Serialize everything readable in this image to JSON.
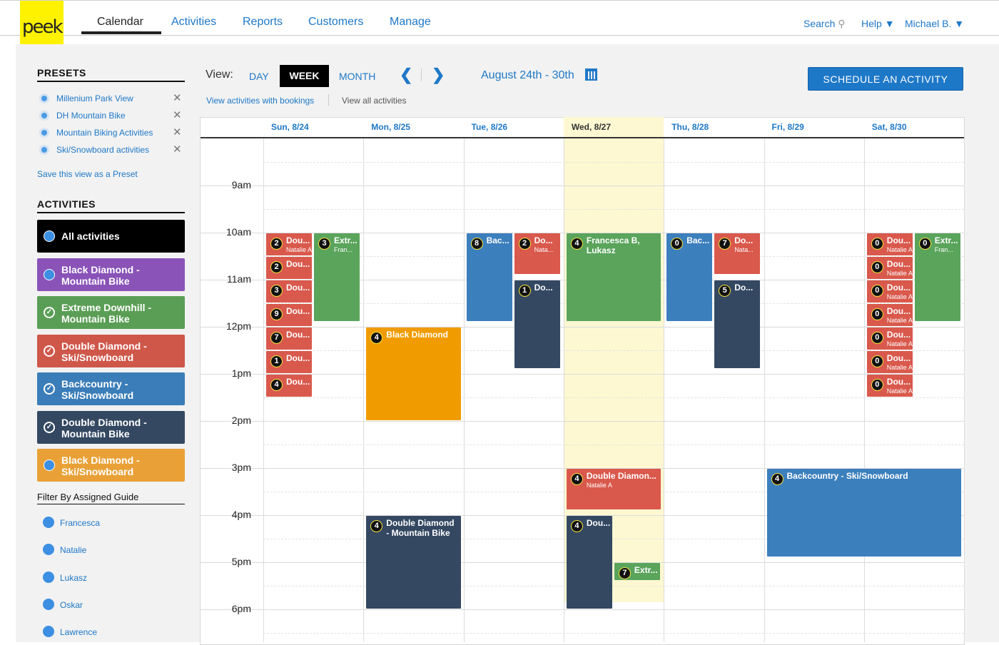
{
  "logo": "peek",
  "nav": {
    "items": [
      "Calendar",
      "Activities",
      "Reports",
      "Customers",
      "Manage"
    ],
    "active": "Calendar"
  },
  "top_right": {
    "search": "Search",
    "help": "Help",
    "user": "Michael B."
  },
  "presets": {
    "title": "PRESETS",
    "items": [
      "Millenium Park View",
      "DH Mountain Bike",
      "Mountain Biking Activities",
      "Ski/Snowboard activities"
    ],
    "save_link": "Save this view as a Preset"
  },
  "activities": {
    "title": "ACTIVITIES",
    "items": [
      {
        "label": "All activities",
        "color": "#000000",
        "state": "dot"
      },
      {
        "label": "Black Diamond - Mountain Bike",
        "color": "#8a53b8",
        "state": "dot"
      },
      {
        "label": "Extreme Downhill - Mountain Bike",
        "color": "#5a9e55",
        "state": "check"
      },
      {
        "label": "Double Diamond - Ski/Snowboard",
        "color": "#cf574a",
        "state": "check"
      },
      {
        "label": "Backcountry - Ski/Snowboard",
        "color": "#3a7db8",
        "state": "check"
      },
      {
        "label": "Double Diamond - Mountain Bike",
        "color": "#344862",
        "state": "check"
      },
      {
        "label": "Black Diamond - Ski/Snowboard",
        "color": "#e9a137",
        "state": "dot"
      }
    ]
  },
  "guides": {
    "title": "Filter By Assigned Guide",
    "items": [
      "Francesca",
      "Natalie",
      "Lukasz",
      "Oskar",
      "Lawrence"
    ]
  },
  "toolbar": {
    "view_label": "View:",
    "views": [
      "DAY",
      "WEEK",
      "MONTH"
    ],
    "active_view": "WEEK",
    "date_range": "August 24th - 30th",
    "schedule_button": "SCHEDULE AN ACTIVITY",
    "link_bookings": "View activities with bookings",
    "link_all": "View all activities"
  },
  "days": [
    {
      "label": "Sun, 8/24",
      "today": false
    },
    {
      "label": "Mon, 8/25",
      "today": false
    },
    {
      "label": "Tue, 8/26",
      "today": false
    },
    {
      "label": "Wed, 8/27",
      "today": true
    },
    {
      "label": "Thu, 8/28",
      "today": false
    },
    {
      "label": "Fri, 8/29",
      "today": false
    },
    {
      "label": "Sat, 8/30",
      "today": false
    }
  ],
  "hours": [
    "9am",
    "10am",
    "11am",
    "12pm",
    "1pm",
    "2pm",
    "3pm",
    "4pm",
    "5pm",
    "6pm"
  ],
  "colors": {
    "red": "#d9594c",
    "green": "#5aa45c",
    "blue": "#3c7fbd",
    "navy": "#344862",
    "orange": "#f09c00",
    "today": "#fdf8d1",
    "brand_blue": "#1e78c8"
  },
  "events": [
    {
      "day": 0,
      "col": 0,
      "start": 10,
      "end": 10.5,
      "color": "red",
      "count": "2",
      "title": "Dou...",
      "sub": "Natalie A"
    },
    {
      "day": 0,
      "col": 0,
      "start": 10.5,
      "end": 11,
      "color": "red",
      "count": "2",
      "title": "Dou...",
      "sub": ""
    },
    {
      "day": 0,
      "col": 0,
      "start": 11,
      "end": 11.5,
      "color": "red",
      "count": "3",
      "title": "Dou...",
      "sub": ""
    },
    {
      "day": 0,
      "col": 0,
      "start": 11.5,
      "end": 12,
      "color": "red",
      "count": "9",
      "title": "Dou...",
      "sub": ""
    },
    {
      "day": 0,
      "col": 0,
      "start": 12,
      "end": 12.5,
      "color": "red",
      "count": "7",
      "title": "Dou...",
      "sub": ""
    },
    {
      "day": 0,
      "col": 0,
      "start": 12.5,
      "end": 13,
      "color": "red",
      "count": "1",
      "title": "Dou...",
      "sub": ""
    },
    {
      "day": 0,
      "col": 0,
      "start": 13,
      "end": 13.5,
      "color": "red",
      "count": "4",
      "title": "Dou...",
      "sub": ""
    },
    {
      "day": 0,
      "col": 1,
      "start": 10,
      "end": 11.9,
      "color": "green",
      "count": "3",
      "title": "Extr...",
      "sub": "Fran..."
    },
    {
      "day": 1,
      "col": -1,
      "start": 12,
      "end": 14,
      "color": "orange",
      "count": "4",
      "title": "Black Diamond",
      "sub": ""
    },
    {
      "day": 1,
      "col": -1,
      "start": 16,
      "end": 18,
      "color": "navy",
      "count": "4",
      "title": "Double Diamond - Mountain Bike",
      "sub": ""
    },
    {
      "day": 2,
      "col": 0,
      "start": 10,
      "end": 11.9,
      "color": "blue",
      "count": "8",
      "title": "Bac...",
      "sub": ""
    },
    {
      "day": 2,
      "col": 1,
      "start": 10,
      "end": 10.9,
      "color": "red",
      "count": "2",
      "title": "Do...",
      "sub": "Nata..."
    },
    {
      "day": 2,
      "col": 1,
      "start": 11,
      "end": 12.9,
      "color": "navy",
      "count": "1",
      "title": "Do...",
      "sub": ""
    },
    {
      "day": 3,
      "col": -1,
      "start": 10,
      "end": 11.9,
      "color": "green",
      "count": "4",
      "title": "Francesca B, Lukasz",
      "sub": ""
    },
    {
      "day": 3,
      "col": -1,
      "start": 15,
      "end": 15.9,
      "color": "red",
      "count": "4",
      "title": "Double Diamon...",
      "sub": "Natalie A"
    },
    {
      "day": 3,
      "col": 0,
      "start": 16,
      "end": 18,
      "color": "navy",
      "count": "4",
      "title": "Dou...",
      "sub": ""
    },
    {
      "day": 3,
      "col": 1,
      "start": 17,
      "end": 17.4,
      "color": "green",
      "count": "7",
      "title": "Extr...",
      "sub": ""
    },
    {
      "day": 4,
      "col": 0,
      "start": 10,
      "end": 11.9,
      "color": "blue",
      "count": "0",
      "title": "Bac...",
      "sub": ""
    },
    {
      "day": 4,
      "col": 1,
      "start": 10,
      "end": 10.9,
      "color": "red",
      "count": "7",
      "title": "Do...",
      "sub": "Nata..."
    },
    {
      "day": 4,
      "col": 1,
      "start": 11,
      "end": 12.9,
      "color": "navy",
      "count": "5",
      "title": "Do...",
      "sub": ""
    },
    {
      "day": 5,
      "col": -1,
      "start": 15,
      "end": 16.9,
      "color": "blue",
      "count": "4",
      "title": "Backcountry - Ski/Snowboard",
      "sub": ""
    },
    {
      "day": 6,
      "col": 0,
      "start": 10,
      "end": 10.5,
      "color": "red",
      "count": "0",
      "title": "Dou...",
      "sub": "Natalie A"
    },
    {
      "day": 6,
      "col": 0,
      "start": 10.5,
      "end": 11,
      "color": "red",
      "count": "0",
      "title": "Dou...",
      "sub": "Natalie A"
    },
    {
      "day": 6,
      "col": 0,
      "start": 11,
      "end": 11.5,
      "color": "red",
      "count": "0",
      "title": "Dou...",
      "sub": "Natalie A"
    },
    {
      "day": 6,
      "col": 0,
      "start": 11.5,
      "end": 12,
      "color": "red",
      "count": "0",
      "title": "Dou...",
      "sub": "Natalie A"
    },
    {
      "day": 6,
      "col": 0,
      "start": 12,
      "end": 12.5,
      "color": "red",
      "count": "0",
      "title": "Dou...",
      "sub": "Natalie A"
    },
    {
      "day": 6,
      "col": 0,
      "start": 12.5,
      "end": 13,
      "color": "red",
      "count": "0",
      "title": "Dou...",
      "sub": "Natalie A"
    },
    {
      "day": 6,
      "col": 0,
      "start": 13,
      "end": 13.5,
      "color": "red",
      "count": "0",
      "title": "Dou...",
      "sub": "Natalie A"
    },
    {
      "day": 6,
      "col": 1,
      "start": 10,
      "end": 11.9,
      "color": "green",
      "count": "0",
      "title": "Extr...",
      "sub": "Fran..."
    }
  ]
}
